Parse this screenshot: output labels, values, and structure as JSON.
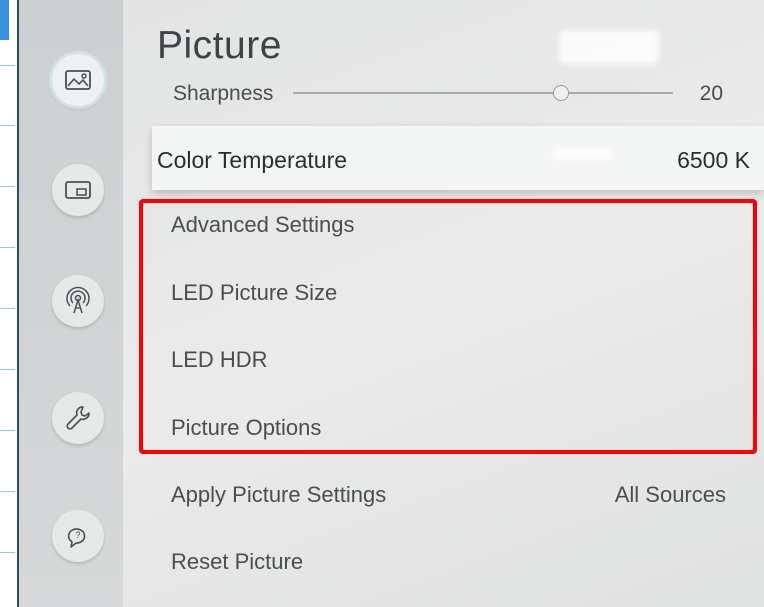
{
  "panel": {
    "title": "Picture",
    "partial_item": {
      "label": "Sharpness",
      "value": "20"
    },
    "selected_item": {
      "label": "Color Temperature",
      "value": "6500 K"
    },
    "items": [
      {
        "label": "Advanced Settings"
      },
      {
        "label": "LED Picture Size"
      },
      {
        "label": "LED HDR"
      },
      {
        "label": "Picture Options"
      },
      {
        "label": "Apply Picture Settings",
        "value": "All Sources"
      },
      {
        "label": "Reset Picture"
      }
    ]
  },
  "sidebar": {
    "icons": [
      "picture-icon",
      "picture-in-picture-icon",
      "broadcast-icon",
      "wrench-icon",
      "support-icon"
    ],
    "active_index": 0
  },
  "annotation": {
    "highlight_color": "#ff0000"
  }
}
